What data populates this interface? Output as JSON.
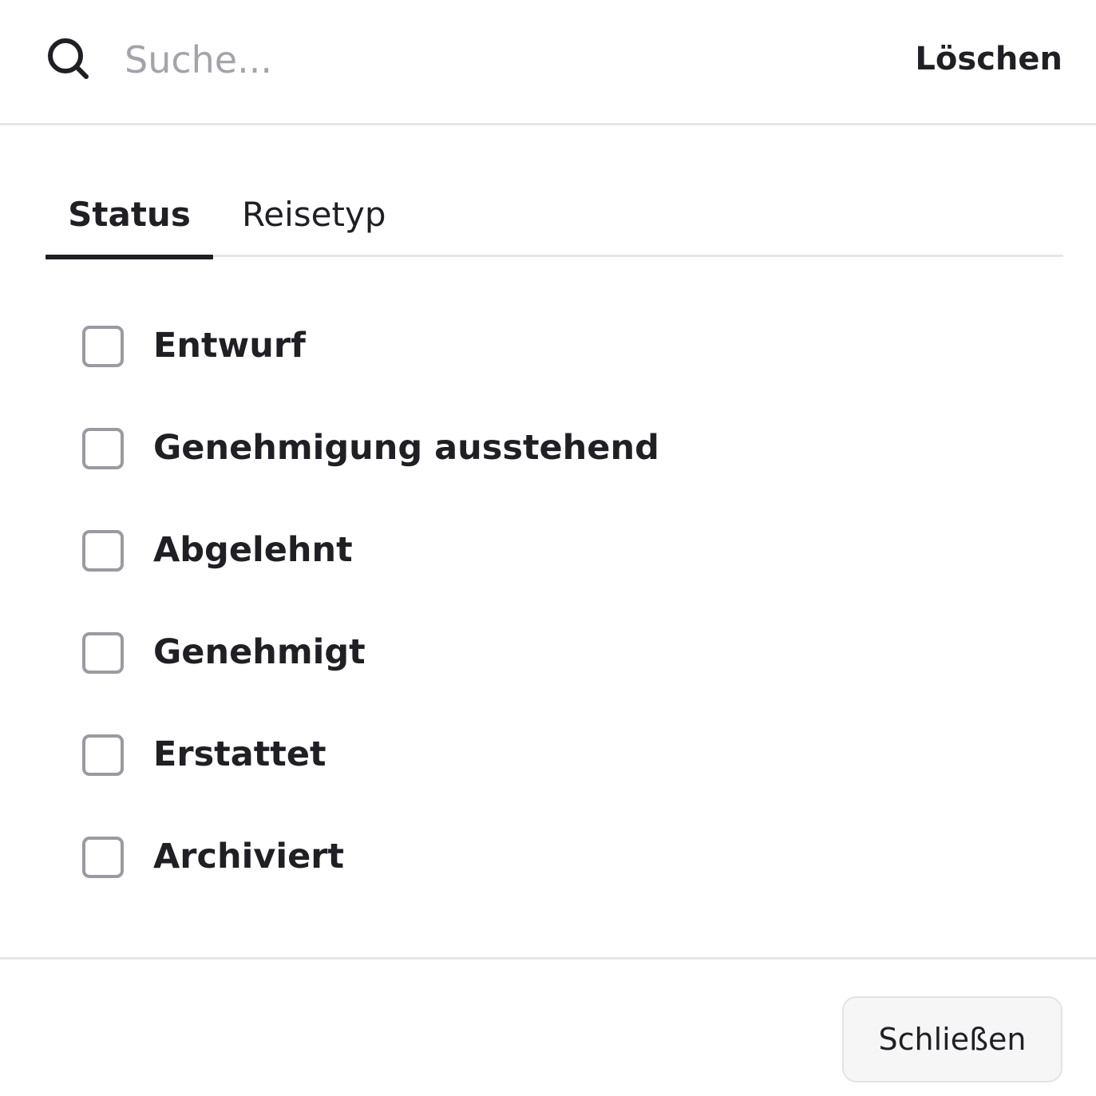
{
  "search": {
    "placeholder": "Suche...",
    "value": "",
    "clear_label": "Löschen"
  },
  "tabs": [
    {
      "label": "Status",
      "active": true
    },
    {
      "label": "Reisetyp",
      "active": false
    }
  ],
  "status_options": [
    {
      "label": "Entwurf",
      "checked": false
    },
    {
      "label": "Genehmigung ausstehend",
      "checked": false
    },
    {
      "label": "Abgelehnt",
      "checked": false
    },
    {
      "label": "Genehmigt",
      "checked": false
    },
    {
      "label": "Erstattet",
      "checked": false
    },
    {
      "label": "Archiviert",
      "checked": false
    }
  ],
  "footer": {
    "close_label": "Schließen"
  },
  "colors": {
    "text": "#1f1f24",
    "placeholder": "#a3a3aa",
    "divider": "#e6e6e9",
    "checkbox_border": "#9a9aa1",
    "button_bg": "#f6f6f7"
  },
  "icons": {
    "search": "search-icon"
  }
}
